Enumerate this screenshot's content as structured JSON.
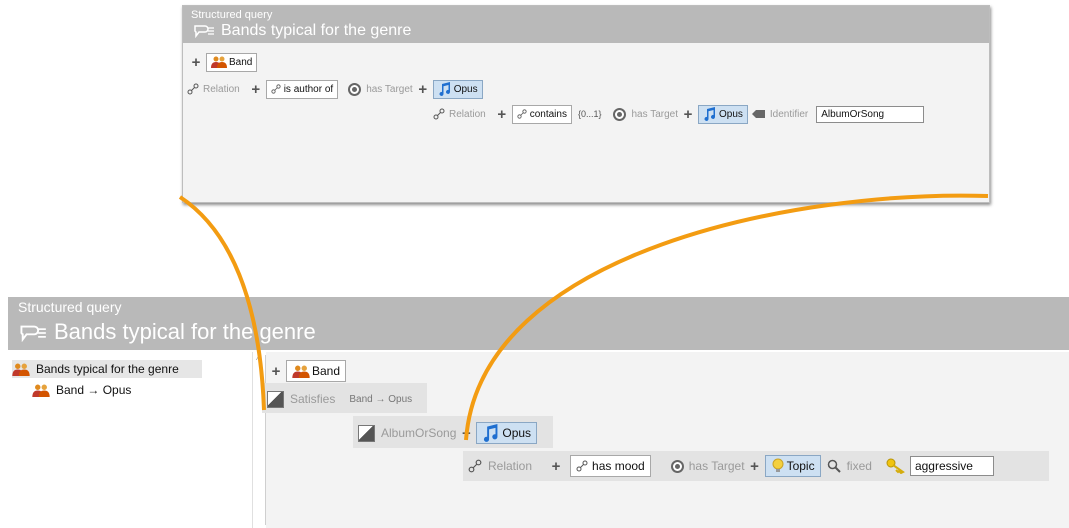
{
  "colors": {
    "accent_curve": "#f39c12",
    "titlebar": "#b9b9b9",
    "selected_chip": "#cde0f2"
  },
  "top_window": {
    "subtitle": "Structured query",
    "title": "Bands typical for the genre",
    "row1": {
      "chip": "Band"
    },
    "row2": {
      "label": "Relation",
      "relation_chip": "is author of",
      "has_target": "has Target",
      "target_chip": "Opus"
    },
    "row3": {
      "label": "Relation",
      "relation_chip": "contains",
      "cardinality": "{0...1}",
      "has_target": "has Target",
      "target_chip": "Opus",
      "identifier_label": "Identifier",
      "identifier_value": "AlbumOrSong"
    }
  },
  "bottom_window": {
    "subtitle": "Structured query",
    "title": "Bands typical for the genre",
    "tree": [
      {
        "label": "Bands typical for the genre",
        "icon": "users-icon"
      },
      {
        "label": "Band → Opus",
        "icon": "users-icon"
      }
    ],
    "row1": {
      "chip": "Band"
    },
    "satisfies": {
      "label": "Satisfies",
      "value": "Band → Opus"
    },
    "opus_row": {
      "identifier": "AlbumOrSong",
      "chip": "Opus"
    },
    "relation_row": {
      "label": "Relation",
      "relation_chip": "has mood",
      "has_target": "has Target",
      "topic_chip": "Topic",
      "fixed_label": "fixed",
      "value": "aggressive"
    }
  }
}
